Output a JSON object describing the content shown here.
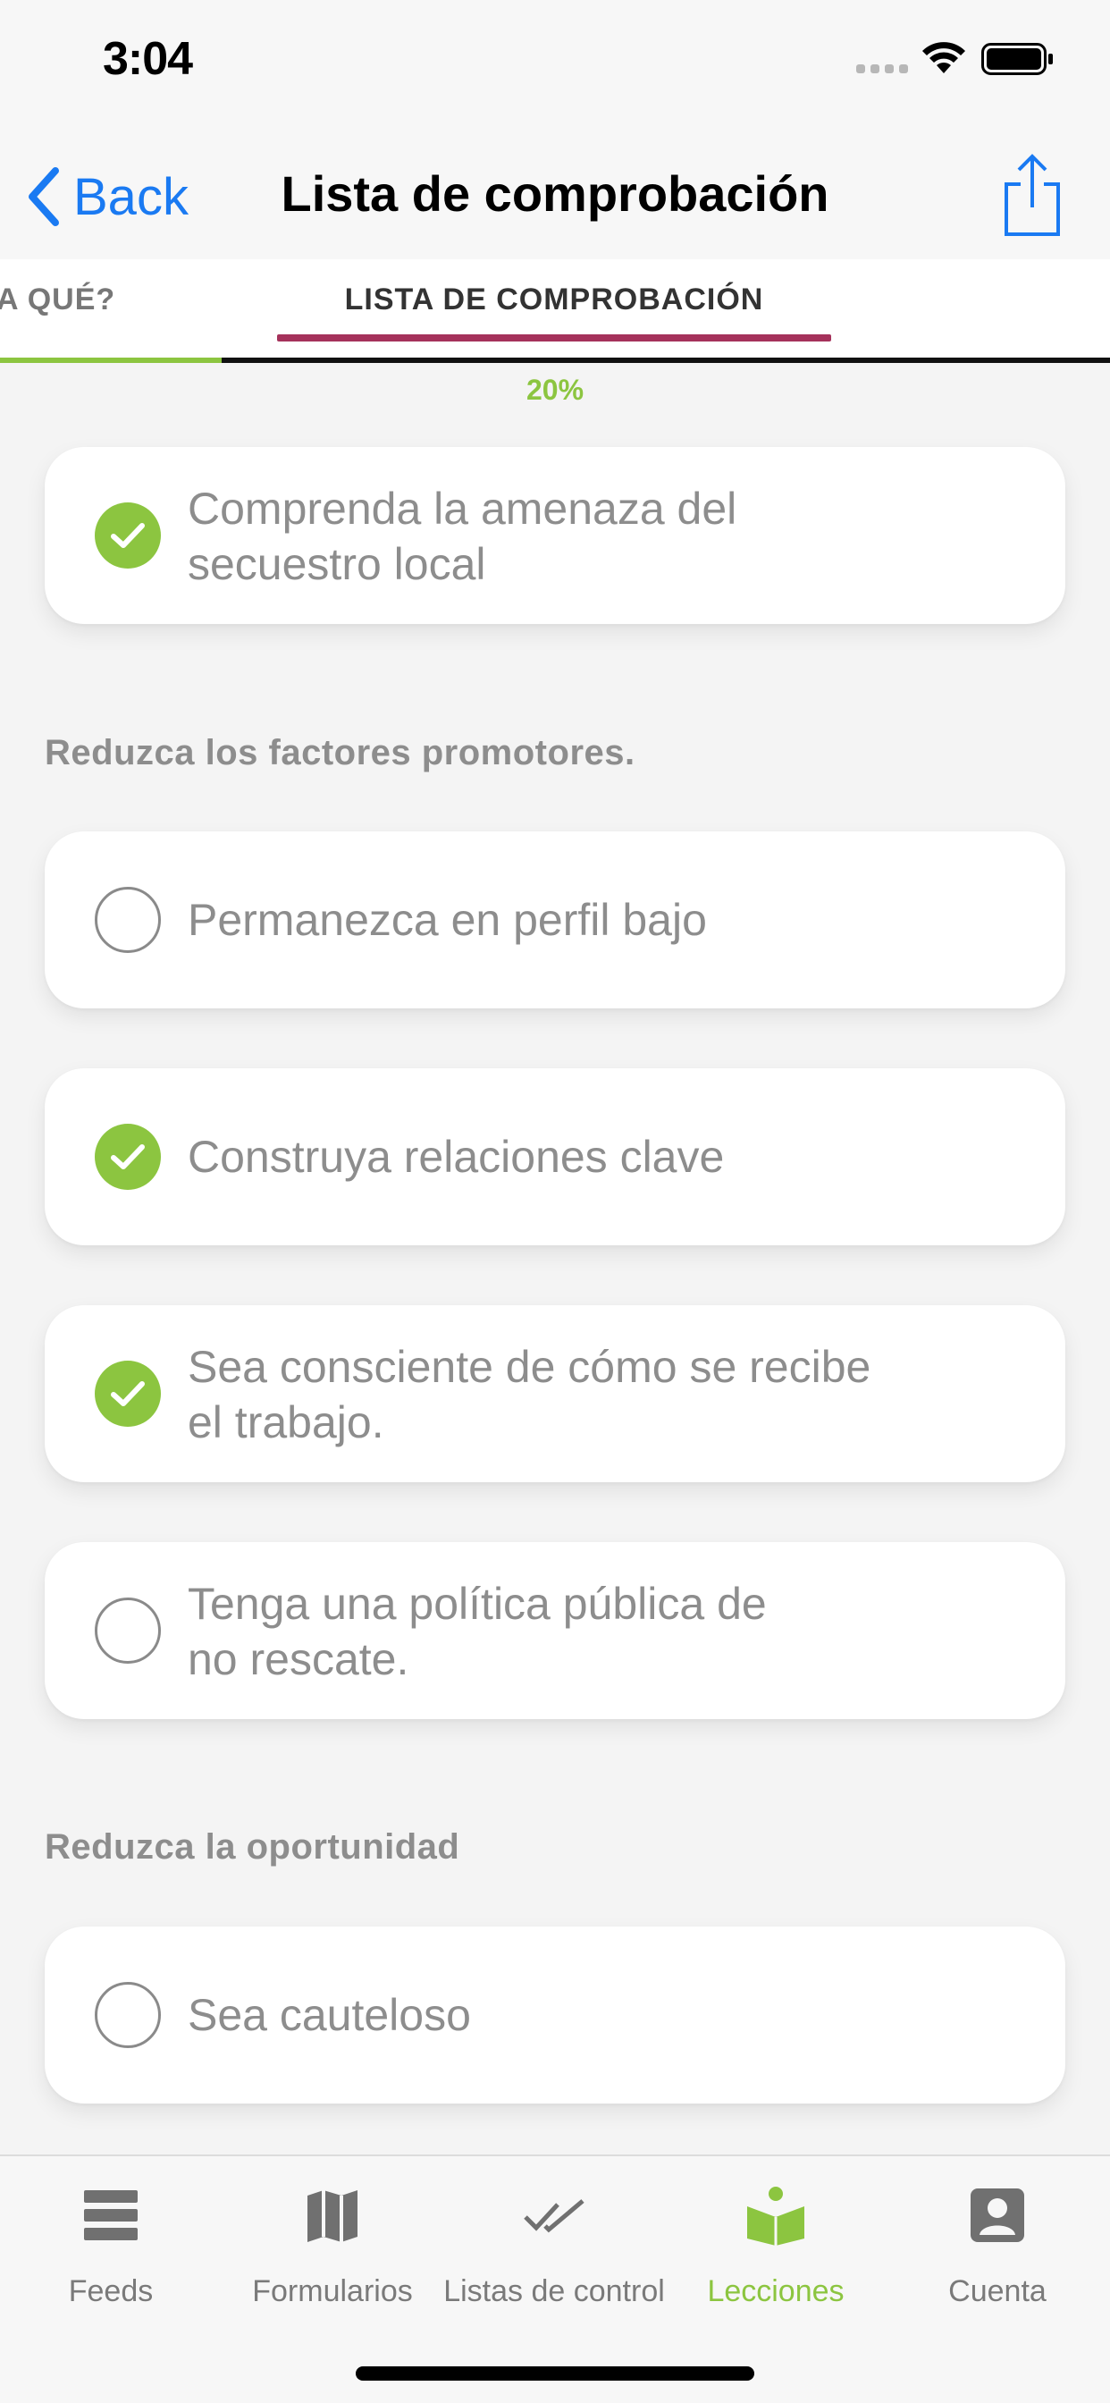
{
  "status_bar": {
    "time": "3:04"
  },
  "nav": {
    "back_label": "Back",
    "title": "Lista de comprobación"
  },
  "tabs": {
    "previous": "A QUÉ?",
    "active": "LISTA DE COMPROBACIÓN"
  },
  "progress": {
    "label": "20%",
    "value": 0.2
  },
  "colors": {
    "accent_green": "#8cc540",
    "tab_underline": "#a5325b",
    "link_blue": "#1a7af2"
  },
  "items": [
    {
      "label": "Comprenda la amenaza del\nsecuestro local",
      "checked": true
    }
  ],
  "sections": [
    {
      "title": "Reduzca los factores promotores.",
      "items": [
        {
          "label": "Permanezca en perfil bajo",
          "checked": false
        },
        {
          "label": "Construya relaciones clave",
          "checked": true
        },
        {
          "label": "Sea consciente de cómo se recibe\nel trabajo.",
          "checked": true
        },
        {
          "label": "Tenga una política pública de\nno rescate.",
          "checked": false
        }
      ]
    },
    {
      "title": "Reduzca la oportunidad",
      "items": [
        {
          "label": "Sea cauteloso",
          "checked": false
        }
      ]
    }
  ],
  "tab_bar": [
    {
      "label": "Feeds",
      "icon": "feeds-icon",
      "active": false
    },
    {
      "label": "Formularios",
      "icon": "map-icon",
      "active": false
    },
    {
      "label": "Listas de control",
      "icon": "double-check-icon",
      "active": false
    },
    {
      "label": "Lecciones",
      "icon": "lessons-icon",
      "active": true
    },
    {
      "label": "Cuenta",
      "icon": "account-icon",
      "active": false
    }
  ]
}
